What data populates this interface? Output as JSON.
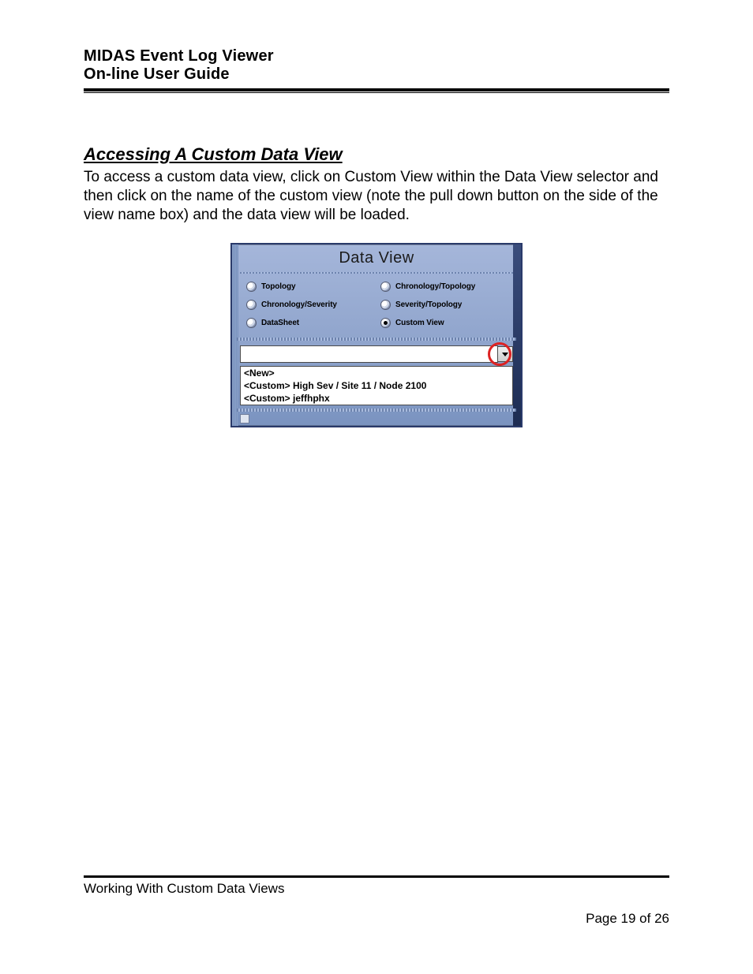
{
  "header": {
    "line1": "MIDAS Event Log Viewer",
    "line2": "On-line User Guide"
  },
  "section": {
    "heading": "Accessing A Custom Data View",
    "paragraph": "To access a custom data view, click on Custom View within the Data View selector and then click on the name of the custom view (note the pull down button on the side of the view name box) and the data view will be loaded."
  },
  "dataview": {
    "title": "Data View",
    "radios": [
      {
        "label": "Topology",
        "selected": false
      },
      {
        "label": "Chronology/Topology",
        "selected": false
      },
      {
        "label": "Chronology/Severity",
        "selected": false
      },
      {
        "label": "Severity/Topology",
        "selected": false
      },
      {
        "label": "DataSheet",
        "selected": false
      },
      {
        "label": "Custom View",
        "selected": true
      }
    ],
    "list": [
      "<New>",
      "<Custom> High Sev / Site 11 / Node 2100",
      "<Custom> jeffhphx"
    ]
  },
  "footer": {
    "section": "Working With Custom Data Views",
    "page": "Page 19 of 26"
  }
}
